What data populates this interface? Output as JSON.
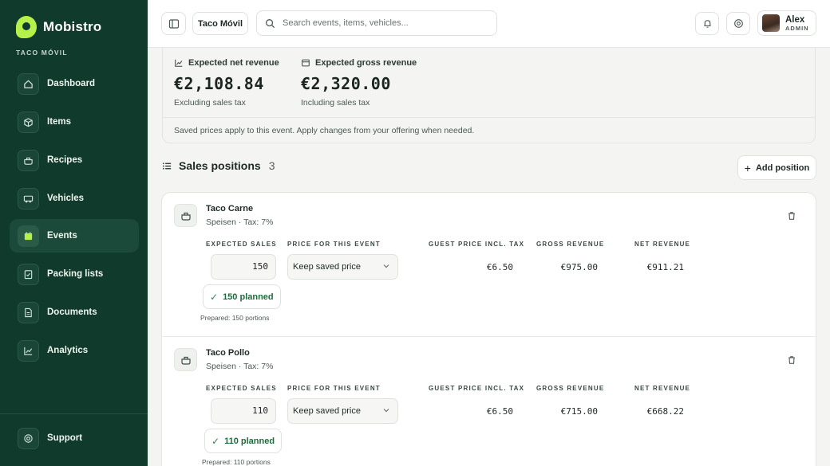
{
  "app": {
    "name": "Mobistro",
    "org": "TACO MÓVIL"
  },
  "sidebar": {
    "items": [
      {
        "label": "Dashboard",
        "icon": "home-icon"
      },
      {
        "label": "Items",
        "icon": "box-icon"
      },
      {
        "label": "Recipes",
        "icon": "pot-icon"
      },
      {
        "label": "Vehicles",
        "icon": "truck-icon"
      },
      {
        "label": "Events",
        "icon": "calendar-icon",
        "active": true
      },
      {
        "label": "Packing lists",
        "icon": "checklist-icon"
      },
      {
        "label": "Documents",
        "icon": "document-icon"
      },
      {
        "label": "Analytics",
        "icon": "chart-icon"
      }
    ],
    "support_label": "Support"
  },
  "topbar": {
    "workspace": "Taco Móvil",
    "search_placeholder": "Search events, items, vehicles...",
    "user": {
      "name": "Alex",
      "role": "ADMIN"
    }
  },
  "revenue": {
    "net_label": "Expected net revenue",
    "net_value": "€2,108.84",
    "net_sub": "Excluding sales tax",
    "gross_label": "Expected gross revenue",
    "gross_value": "€2,320.00",
    "gross_sub": "Including sales tax",
    "note": "Saved prices apply to this event. Apply changes from your offering when needed."
  },
  "sales_positions": {
    "title": "Sales positions",
    "count": "3",
    "add_label": "Add position",
    "columns": {
      "expected_sales": "EXPECTED SALES",
      "price": "PRICE FOR THIS EVENT",
      "guest_price": "GUEST PRICE INCL. TAX",
      "gross": "GROSS REVENUE",
      "net": "NET REVENUE"
    },
    "items": [
      {
        "name": "Taco Carne",
        "meta": "Speisen · Tax: 7%",
        "expected_sales": "150",
        "planned": "150 planned",
        "prepared": "Prepared: 150 portions",
        "price_option": "Keep saved price",
        "guest_price": "€6.50",
        "gross": "€975.00",
        "net": "€911.21"
      },
      {
        "name": "Taco Pollo",
        "meta": "Speisen · Tax: 7%",
        "expected_sales": "110",
        "planned": "110 planned",
        "prepared": "Prepared: 110 portions",
        "price_option": "Keep saved price",
        "guest_price": "€6.50",
        "gross": "€715.00",
        "net": "€668.22"
      }
    ]
  }
}
